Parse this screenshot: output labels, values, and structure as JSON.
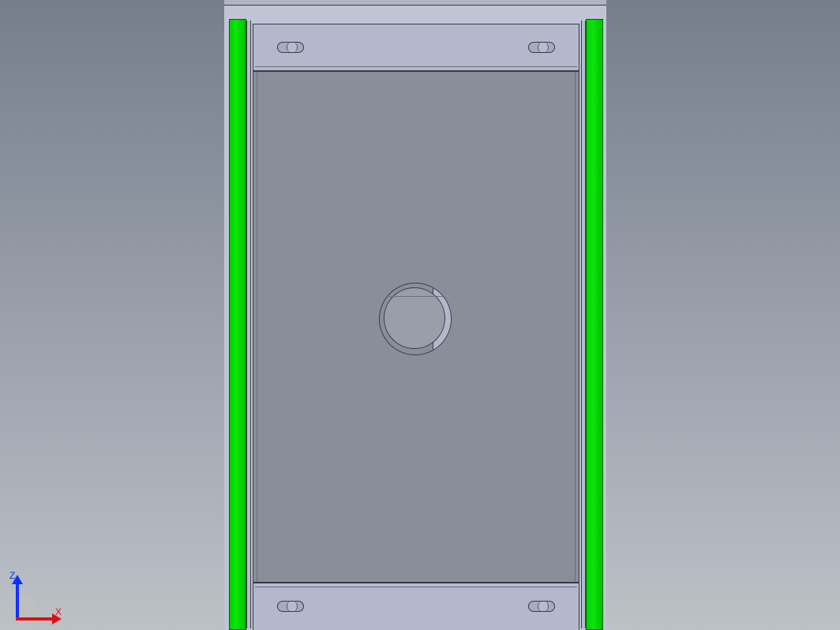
{
  "triad": {
    "axis_vertical_label": "Z",
    "axis_horizontal_label": "X"
  },
  "model": {
    "colors": {
      "rail": "#0ae60a",
      "flange": "#b4b8cd",
      "panel": "#8a8e99",
      "background_top": "#767e8d",
      "background_bottom": "#bcc1c7"
    }
  }
}
